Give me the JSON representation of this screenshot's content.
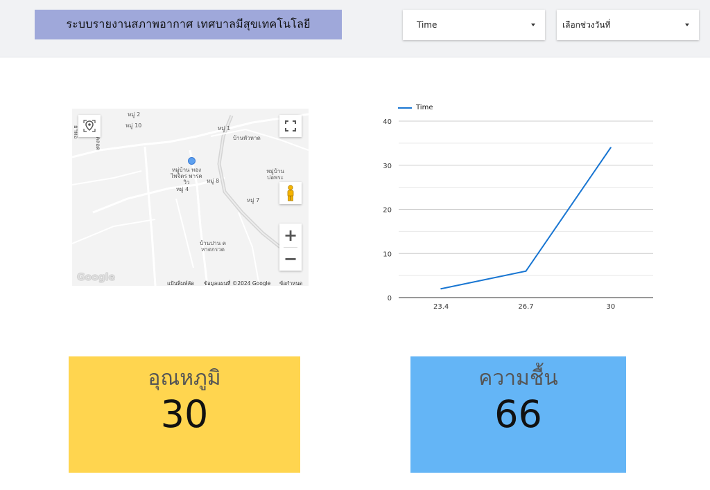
{
  "header": {
    "title": "ระบบรายงานสภาพอากาศ เทศบาลมีสุขเทคโนโลยี",
    "time_dropdown": {
      "value": "Time"
    },
    "date_dropdown": {
      "value": "เลือกช่วงวันที่"
    }
  },
  "map": {
    "labels": [
      "หมู่ 2",
      "หมู่ 10",
      "หมู่ 1",
      "บ้านหัวหาด",
      "หมู่บ้าน ทองไพจิตร พารควิว",
      "หมู่ 8",
      "หมู่ 4",
      "หมู่บ้าน บ่อพระ",
      "หมู่ 7",
      "บ้านปาน ต หาดกรวด"
    ],
    "side_label_1": "ยาทอ",
    "side_label_2": "คลอด",
    "google": "Google",
    "footer_shortcuts": "แป้นพิมพ์ลัด",
    "footer_data": "ข้อมูลแผนที่ ©2024 Google",
    "footer_terms": "ข้อกำหนด",
    "zoom_in": "+",
    "zoom_out": "−"
  },
  "chart_data": {
    "type": "line",
    "x": [
      "23.4",
      "26.7",
      "30"
    ],
    "series": [
      {
        "name": "Time",
        "values": [
          2,
          6,
          34
        ]
      }
    ],
    "yticks": [
      "0",
      "10",
      "20",
      "30",
      "40"
    ],
    "ylim": [
      0,
      40
    ],
    "grid": true,
    "legend": "top-left",
    "color": "#1976d2"
  },
  "cards": {
    "temperature": {
      "title": "อุณหภูมิ",
      "value": "30",
      "color": "#ffd54f"
    },
    "humidity": {
      "title": "ความชื้น",
      "value": "66",
      "color": "#64b5f6"
    }
  }
}
